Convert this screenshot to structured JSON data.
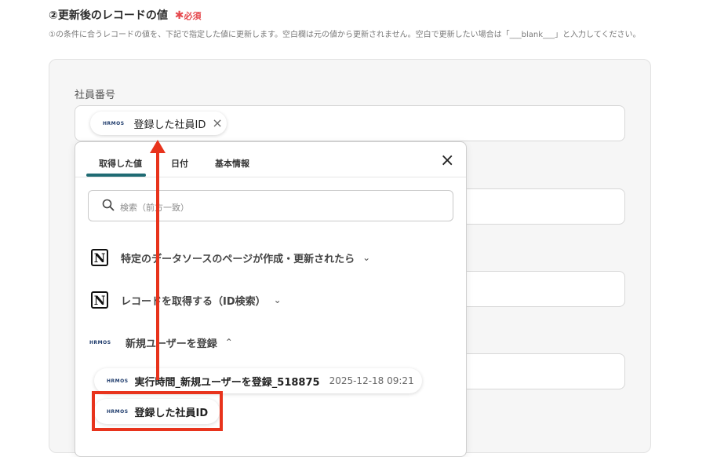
{
  "section": {
    "title": "②更新後のレコードの値",
    "required_mark": "✱",
    "required_label": "必須",
    "description": "①の条件に合うレコードの値を、下記で指定した値に更新します。空白欄は元の値から更新されません。空白で更新したい場合は「___blank___」と入力してください。"
  },
  "field": {
    "label": "社員番号",
    "chip": {
      "logo": "HRMOS",
      "label": "登録した社員ID",
      "remove": "×"
    }
  },
  "dropdown": {
    "tabs": [
      "取得した値",
      "日付",
      "基本情報"
    ],
    "active_tab": "取得した値",
    "close": "×",
    "search_placeholder": "検索（前方一致）",
    "groups": [
      {
        "icon": "notion-icon",
        "label": "特定のデータソースのページが作成・更新されたら",
        "chevron": "⌄"
      },
      {
        "icon": "notion-icon",
        "label": "レコードを取得する（ID検索）",
        "chevron": "⌄"
      },
      {
        "icon": "hrmos-logo",
        "logo": "HRMOS",
        "label": "新規ユーザーを登録",
        "chevron": "⌃"
      }
    ],
    "values": [
      {
        "logo": "HRMOS",
        "label": "実行時間_新規ユーザーを登録_518875",
        "time": "2025-12-18 09:21"
      },
      {
        "logo": "HRMOS",
        "label": "登録した社員ID",
        "time": ""
      }
    ]
  },
  "colors": {
    "accent": "#1f6b73",
    "annotation": "#e8331c",
    "required": "#e5484d"
  }
}
